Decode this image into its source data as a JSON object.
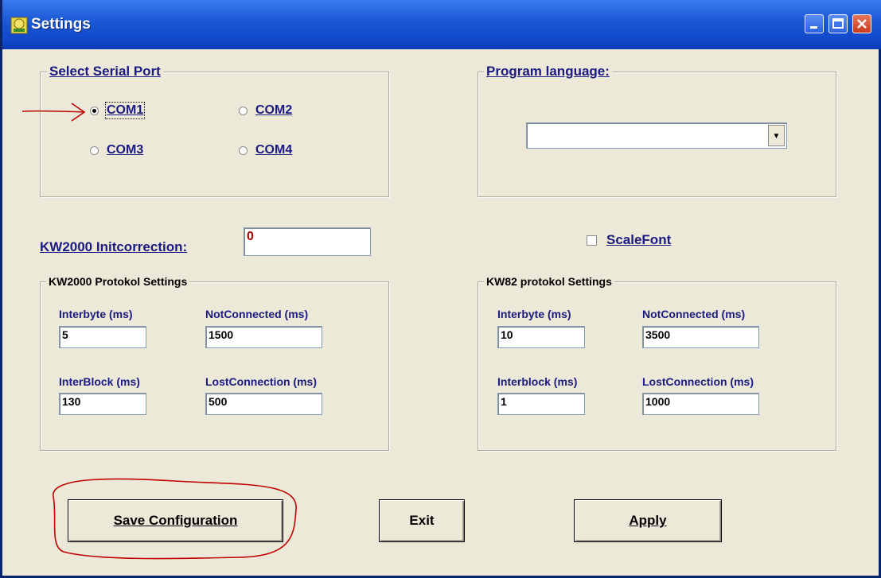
{
  "window": {
    "title": "Settings",
    "controls": [
      "minimize-icon",
      "maximize-icon",
      "close-icon"
    ]
  },
  "serial_port": {
    "title": "Select Serial Port",
    "options": [
      {
        "label": "COM1",
        "selected": true
      },
      {
        "label": "COM2",
        "selected": false
      },
      {
        "label": "COM3",
        "selected": false
      },
      {
        "label": "COM4",
        "selected": false
      }
    ]
  },
  "program_language": {
    "title": "Program language:",
    "selected": ""
  },
  "kw2000_initcorrection": {
    "label": "KW2000 Initcorrection:",
    "value": "0"
  },
  "scale_font": {
    "label": "ScaleFont",
    "checked": false
  },
  "kw2000": {
    "title": "KW2000 Protokol Settings",
    "interbyte_label": "Interbyte (ms)",
    "interbyte": "5",
    "notconnected_label": "NotConnected (ms)",
    "notconnected": "1500",
    "interblock_label": "InterBlock (ms)",
    "interblock": "130",
    "lostconnection_label": "LostConnection (ms)",
    "lostconnection": "500"
  },
  "kw82": {
    "title": "KW82 protokol Settings",
    "interbyte_label": "Interbyte (ms)",
    "interbyte": "10",
    "notconnected_label": "NotConnected (ms)",
    "notconnected": "3500",
    "interblock_label": "Interblock (ms)",
    "interblock": "1",
    "lostconnection_label": "LostConnection (ms)",
    "lostconnection": "1000"
  },
  "buttons": {
    "save": "Save Configuration",
    "exit": "Exit",
    "apply": "Apply"
  },
  "colors": {
    "title_bar": "#0e46c8",
    "label_blue": "#1a1a80",
    "annotation_red": "#c00000",
    "dialog_bg": "#ece9d8"
  }
}
